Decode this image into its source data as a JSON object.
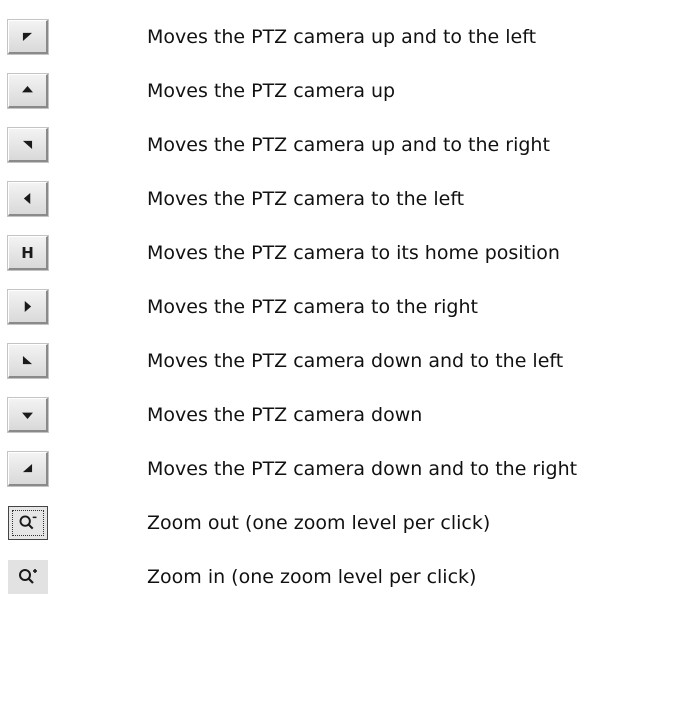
{
  "rows": [
    {
      "icon": "pan-up-left-icon",
      "description": "Moves the PTZ camera up and to the left"
    },
    {
      "icon": "pan-up-icon",
      "description": "Moves the PTZ camera up"
    },
    {
      "icon": "pan-up-right-icon",
      "description": "Moves the PTZ camera up and to the right"
    },
    {
      "icon": "pan-left-icon",
      "description": "Moves the PTZ camera to the left"
    },
    {
      "icon": "home-icon",
      "label": "H",
      "description": "Moves the PTZ camera to its home position"
    },
    {
      "icon": "pan-right-icon",
      "description": "Moves the PTZ camera to the right"
    },
    {
      "icon": "pan-down-left-icon",
      "description": "Moves the PTZ camera down and to the left"
    },
    {
      "icon": "pan-down-icon",
      "description": "Moves the PTZ camera down"
    },
    {
      "icon": "pan-down-right-icon",
      "description": "Moves the PTZ camera down and to the right"
    },
    {
      "icon": "zoom-out-icon",
      "description": "Zoom out (one zoom level per click)"
    },
    {
      "icon": "zoom-in-icon",
      "description": "Zoom in (one zoom level per click)"
    }
  ]
}
